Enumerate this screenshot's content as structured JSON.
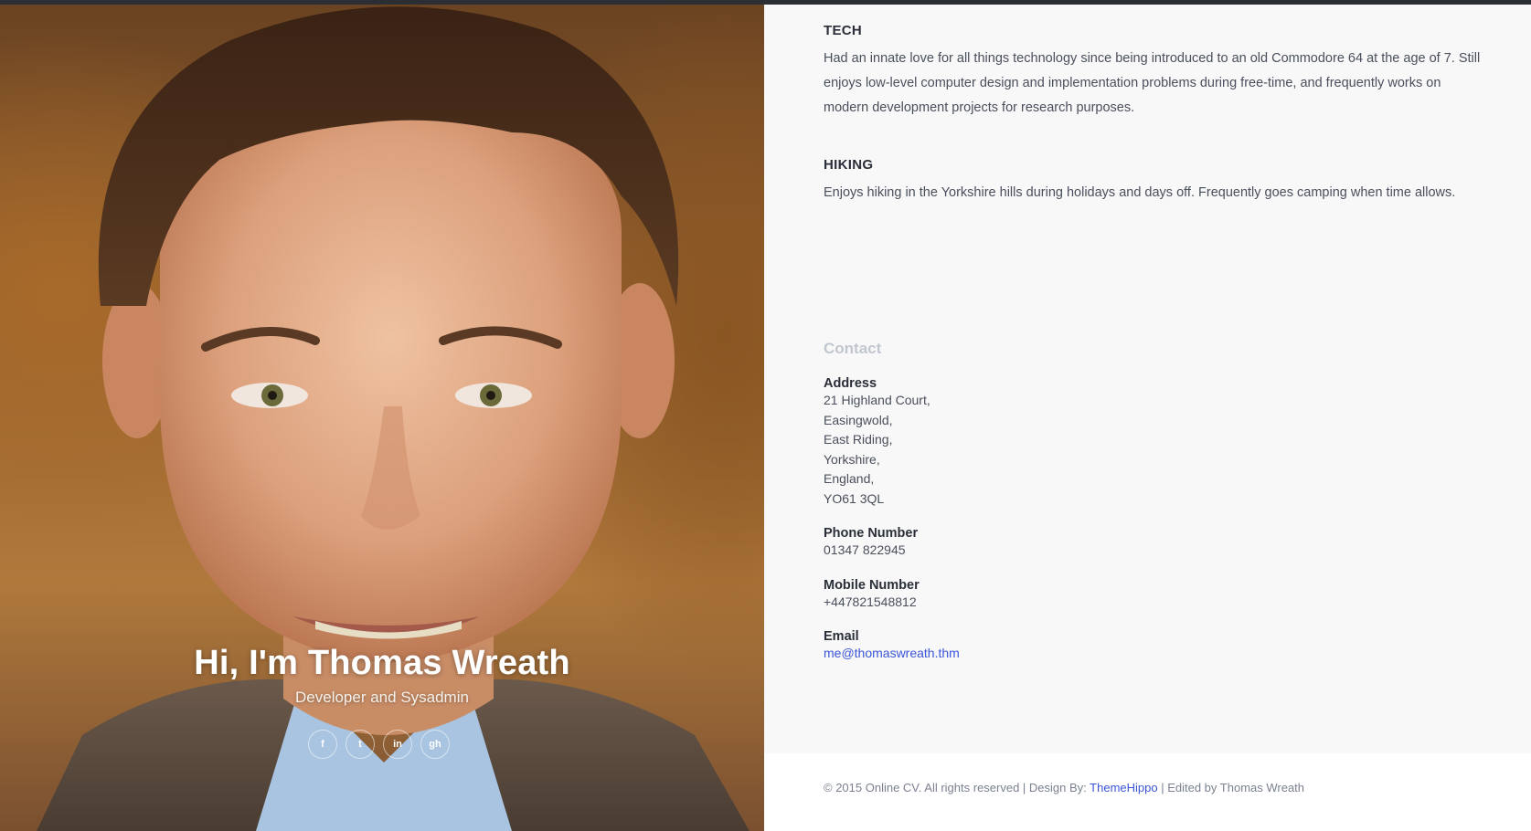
{
  "hero": {
    "title": "Hi, I'm Thomas Wreath",
    "subtitle": "Developer and Sysadmin",
    "socials": [
      {
        "icon": "facebook-icon",
        "glyph": "f"
      },
      {
        "icon": "twitter-icon",
        "glyph": "t"
      },
      {
        "icon": "linkedin-icon",
        "glyph": "in"
      },
      {
        "icon": "github-icon",
        "glyph": "gh"
      }
    ]
  },
  "interests": [
    {
      "heading": "TECH",
      "text": "Had an innate love for all things technology since being introduced to an old Commodore 64 at the age of 7. Still enjoys low-level computer design and implementation problems during free-time, and frequently works on modern development projects for research purposes."
    },
    {
      "heading": "HIKING",
      "text": "Enjoys hiking in the Yorkshire hills during holidays and days off. Frequently goes camping when time allows."
    }
  ],
  "contact": {
    "title": "Contact",
    "address_label": "Address",
    "address_lines": [
      "21 Highland Court,",
      "Easingwold,",
      "East Riding,",
      "Yorkshire,",
      "England,",
      "YO61 3QL"
    ],
    "phone_label": "Phone Number",
    "phone": "01347 822945",
    "mobile_label": "Mobile Number",
    "mobile": "+447821548812",
    "email_label": "Email",
    "email": "me@thomaswreath.thm"
  },
  "footer": {
    "prefix": "© 2015 Online CV. All rights reserved | Design By: ",
    "link": "ThemeHippo",
    "suffix": " | Edited by Thomas Wreath"
  },
  "colors": {
    "accent_link": "#3b55d9",
    "panel_bg": "#f8f8f8",
    "heading_dark": "#2a2e38",
    "contact_title": "#c2c6cf"
  }
}
